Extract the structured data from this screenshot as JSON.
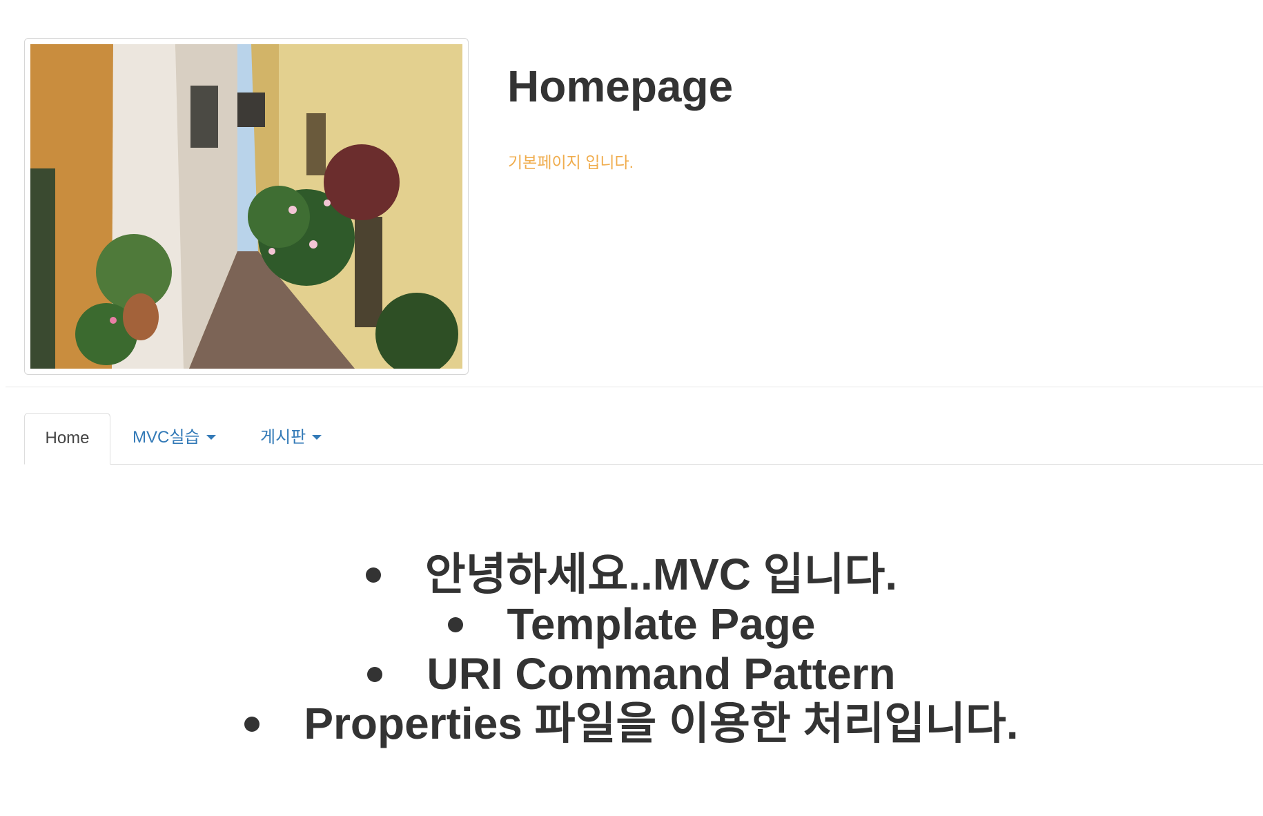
{
  "header": {
    "title": "Homepage",
    "subtitle": "기본페이지 입니다."
  },
  "nav": {
    "tabs": [
      {
        "label": "Home",
        "active": true
      },
      {
        "label": "MVC실습",
        "dropdown": true
      },
      {
        "label": "게시판",
        "dropdown": true
      }
    ]
  },
  "content": {
    "items": [
      "안녕하세요..MVC 입니다.",
      "Template Page",
      "URI Command Pattern",
      "Properties 파일을 이용한 처리입니다."
    ]
  },
  "colors": {
    "subtitle": "#f0ad4e",
    "link": "#337ab7",
    "text": "#333333"
  }
}
